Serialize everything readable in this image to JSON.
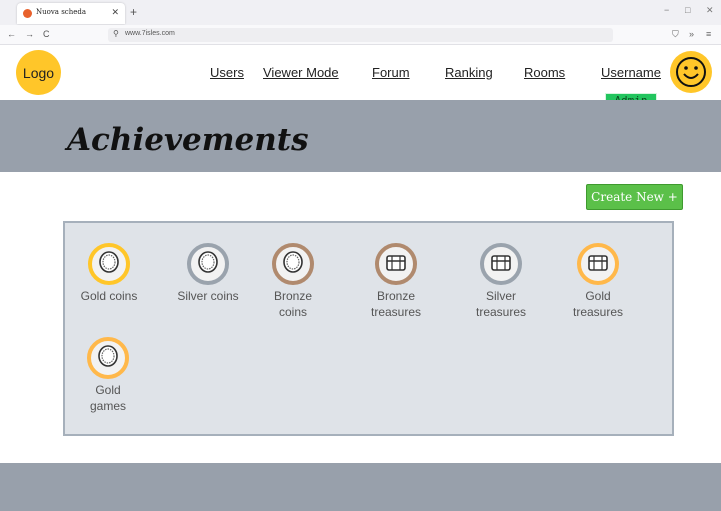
{
  "browser": {
    "tab_title": "Nuova scheda",
    "tab_close": "✕",
    "new_tab": "+",
    "minimize": "−",
    "maximize": "□",
    "close": "✕",
    "back": "←",
    "forward": "→",
    "reload": "C",
    "url": "www.7isles.com",
    "shield": "⛉",
    "more": "»",
    "menu": "≡"
  },
  "header": {
    "logo": "Logo",
    "nav": [
      "Users",
      "Viewer Mode",
      "Forum",
      "Ranking",
      "Rooms",
      "Username"
    ],
    "role_badge": "Admin"
  },
  "page": {
    "title": "Achievements",
    "create_button": "Create New +"
  },
  "achievements": [
    {
      "label": "Gold coins",
      "icon": "coin-icon",
      "ring": "#ffc629"
    },
    {
      "label": "Silver coins",
      "icon": "coin-icon",
      "ring": "#9aa3ad"
    },
    {
      "label": "Bronze coins",
      "icon": "coin-icon",
      "ring": "#b08a6e"
    },
    {
      "label": "Bronze treasures",
      "icon": "treasure-chest-icon",
      "ring": "#b08a6e"
    },
    {
      "label": "Silver treasures",
      "icon": "treasure-chest-icon",
      "ring": "#9aa3ad"
    },
    {
      "label": "Gold treasures",
      "icon": "treasure-chest-icon",
      "ring": "#ffb84a"
    },
    {
      "label": "Gold games",
      "icon": "coin-icon",
      "ring": "#ffb84a"
    }
  ],
  "colors": {
    "accent_yellow": "#ffc629",
    "band_gray": "#98a0ab",
    "create_green": "#5bc049",
    "admin_green": "#22c55e"
  }
}
